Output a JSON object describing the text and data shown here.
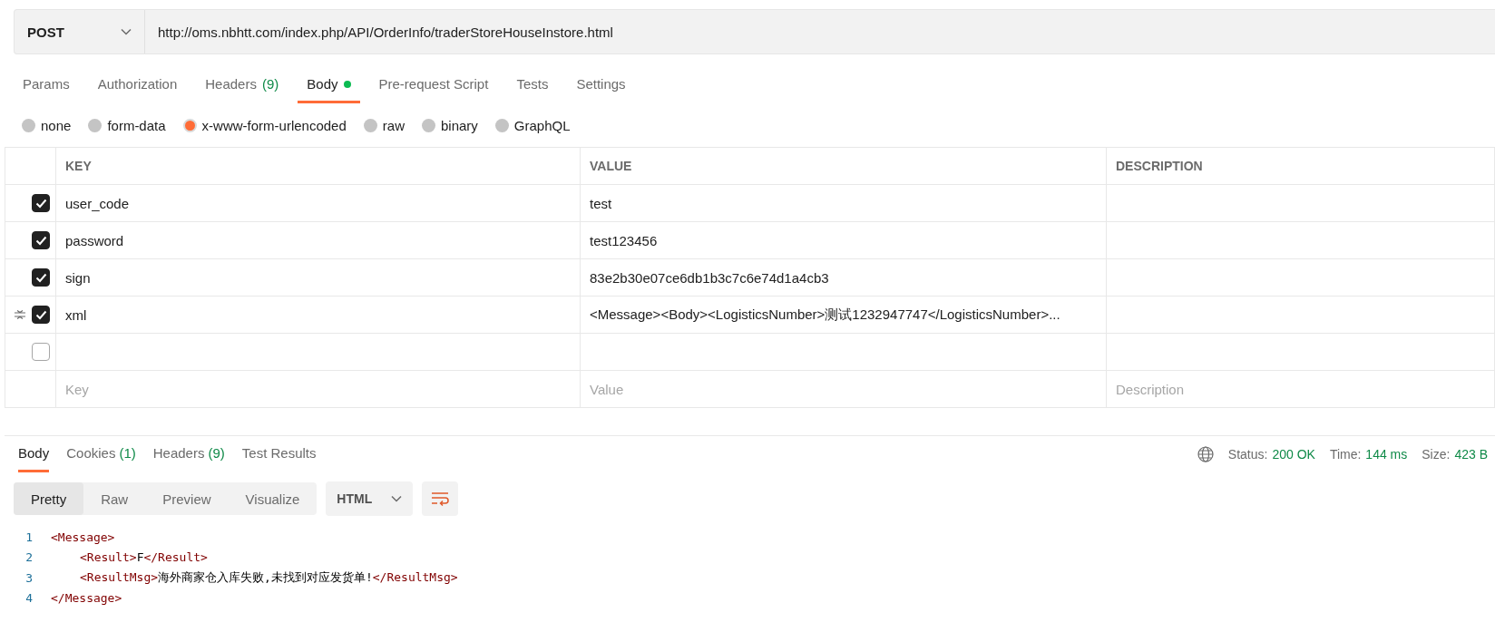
{
  "request": {
    "method": "POST",
    "url": "http://oms.nbhtt.com/index.php/API/OrderInfo/traderStoreHouseInstore.html"
  },
  "request_tabs": [
    {
      "label": "Params",
      "selected": false
    },
    {
      "label": "Authorization",
      "selected": false
    },
    {
      "label": "Headers",
      "count": "(9)",
      "selected": false
    },
    {
      "label": "Body",
      "dot": true,
      "selected": true
    },
    {
      "label": "Pre-request Script",
      "selected": false
    },
    {
      "label": "Tests",
      "selected": false
    },
    {
      "label": "Settings",
      "selected": false
    }
  ],
  "body_types": [
    {
      "label": "none",
      "selected": false
    },
    {
      "label": "form-data",
      "selected": false
    },
    {
      "label": "x-www-form-urlencoded",
      "selected": true
    },
    {
      "label": "raw",
      "selected": false
    },
    {
      "label": "binary",
      "selected": false
    },
    {
      "label": "GraphQL",
      "selected": false
    }
  ],
  "table": {
    "columns": [
      "KEY",
      "VALUE",
      "DESCRIPTION"
    ],
    "rows": [
      {
        "key": "user_code",
        "value": "test",
        "checked": true
      },
      {
        "key": "password",
        "value": "test123456",
        "checked": true
      },
      {
        "key": "sign",
        "value": "83e2b30e07ce6db1b3c7c6e74d1a4cb3",
        "checked": true
      },
      {
        "key": "xml",
        "value": "<Message><Body><LogisticsNumber>测试1232947747</LogisticsNumber>...",
        "checked": true,
        "handle": true
      },
      {
        "checked": false
      }
    ],
    "placeholders": {
      "key": "Key",
      "value": "Value",
      "description": "Description"
    }
  },
  "response_tabs": [
    {
      "label": "Body",
      "selected": true
    },
    {
      "label": "Cookies",
      "count": "(1)",
      "selected": false
    },
    {
      "label": "Headers",
      "count": "(9)",
      "selected": false
    },
    {
      "label": "Test Results",
      "selected": false
    }
  ],
  "response_meta": [
    {
      "label": "Status:",
      "value": "200 OK"
    },
    {
      "label": "Time:",
      "value": "144 ms"
    },
    {
      "label": "Size:",
      "value": "423 B"
    }
  ],
  "view_modes": [
    {
      "label": "Pretty",
      "selected": true
    },
    {
      "label": "Raw",
      "selected": false
    },
    {
      "label": "Preview",
      "selected": false
    },
    {
      "label": "Visualize",
      "selected": false
    }
  ],
  "format": "HTML",
  "code_lines": [
    {
      "number": "1",
      "tokens": [
        {
          "kind": "tag",
          "text": "<Message>"
        }
      ]
    },
    {
      "number": "2",
      "indent": true,
      "tokens": [
        {
          "kind": "tag",
          "text": "<Result>"
        },
        {
          "kind": "text",
          "text": "F"
        },
        {
          "kind": "tag",
          "text": "</Result>"
        }
      ]
    },
    {
      "number": "3",
      "indent": true,
      "tokens": [
        {
          "kind": "tag",
          "text": "<ResultMsg>"
        },
        {
          "kind": "text",
          "text": "海外商家仓入库失败,未找到对应发货单!"
        },
        {
          "kind": "tag",
          "text": "</ResultMsg>"
        }
      ]
    },
    {
      "number": "4",
      "tokens": [
        {
          "kind": "tag",
          "text": "</Message>"
        }
      ]
    }
  ]
}
